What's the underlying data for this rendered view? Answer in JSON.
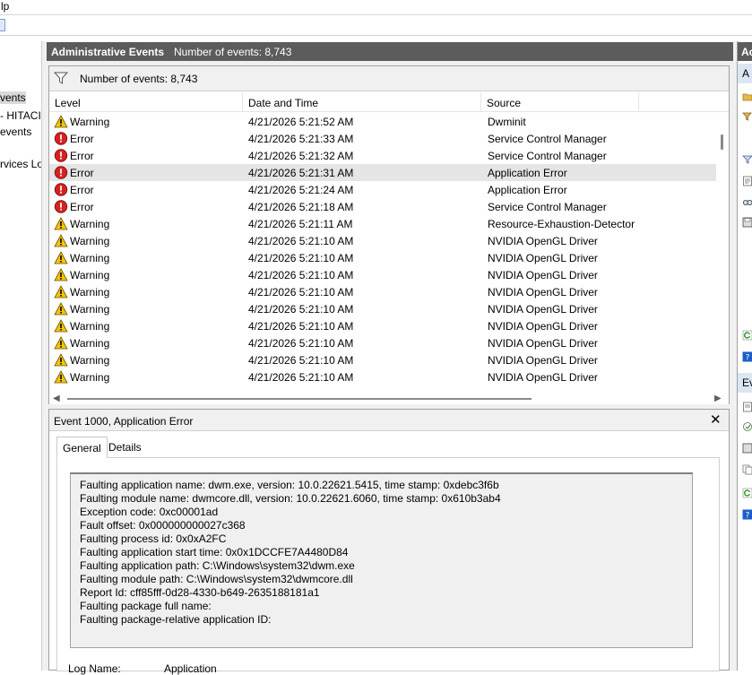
{
  "menubar": {
    "help_fragment": "lp"
  },
  "tree": {
    "items": [
      {
        "label": "vents",
        "selected": true
      },
      {
        "label": "- HITACI",
        "selected": false
      },
      {
        "label": "events",
        "selected": false
      },
      {
        "label": "rvices Lo",
        "selected": false
      }
    ]
  },
  "header": {
    "title": "Administrative Events",
    "count": "Number of events: 8,743"
  },
  "filter": {
    "text": "Number of events: 8,743"
  },
  "grid": {
    "columns": [
      "Level",
      "Date and Time",
      "Source"
    ],
    "rows": [
      {
        "level": "Warning",
        "datetime": "4/21/2026 5:21:52 AM",
        "source": "Dwminit"
      },
      {
        "level": "Error",
        "datetime": "4/21/2026 5:21:33 AM",
        "source": "Service Control Manager"
      },
      {
        "level": "Error",
        "datetime": "4/21/2026 5:21:32 AM",
        "source": "Service Control Manager"
      },
      {
        "level": "Error",
        "datetime": "4/21/2026 5:21:31 AM",
        "source": "Application Error"
      },
      {
        "level": "Error",
        "datetime": "4/21/2026 5:21:24 AM",
        "source": "Application Error"
      },
      {
        "level": "Error",
        "datetime": "4/21/2026 5:21:18 AM",
        "source": "Service Control Manager"
      },
      {
        "level": "Warning",
        "datetime": "4/21/2026 5:21:11 AM",
        "source": "Resource-Exhaustion-Detector"
      },
      {
        "level": "Warning",
        "datetime": "4/21/2026 5:21:10 AM",
        "source": "NVIDIA OpenGL Driver"
      },
      {
        "level": "Warning",
        "datetime": "4/21/2026 5:21:10 AM",
        "source": "NVIDIA OpenGL Driver"
      },
      {
        "level": "Warning",
        "datetime": "4/21/2026 5:21:10 AM",
        "source": "NVIDIA OpenGL Driver"
      },
      {
        "level": "Warning",
        "datetime": "4/21/2026 5:21:10 AM",
        "source": "NVIDIA OpenGL Driver"
      },
      {
        "level": "Warning",
        "datetime": "4/21/2026 5:21:10 AM",
        "source": "NVIDIA OpenGL Driver"
      },
      {
        "level": "Warning",
        "datetime": "4/21/2026 5:21:10 AM",
        "source": "NVIDIA OpenGL Driver"
      },
      {
        "level": "Warning",
        "datetime": "4/21/2026 5:21:10 AM",
        "source": "NVIDIA OpenGL Driver"
      },
      {
        "level": "Warning",
        "datetime": "4/21/2026 5:21:10 AM",
        "source": "NVIDIA OpenGL Driver"
      },
      {
        "level": "Warning",
        "datetime": "4/21/2026 5:21:10 AM",
        "source": "NVIDIA OpenGL Driver"
      }
    ],
    "selected_row": 3
  },
  "detail": {
    "title": "Event 1000, Application Error",
    "close": "✕",
    "tabs": [
      "General",
      "Details"
    ],
    "active_tab": 0,
    "description": [
      "Faulting application name: dwm.exe, version: 10.0.22621.5415, time stamp: 0xdebc3f6b",
      "Faulting module name: dwmcore.dll, version: 10.0.22621.6060, time stamp: 0x610b3ab4",
      "Exception code: 0xc00001ad",
      "Fault offset: 0x000000000027c368",
      "Faulting process id: 0x0xA2FC",
      "Faulting application start time: 0x0x1DCCFE7A4480D84",
      "Faulting application path: C:\\Windows\\system32\\dwm.exe",
      "Faulting module path: C:\\Windows\\system32\\dwmcore.dll",
      "Report Id: cff85fff-0d28-4330-b649-2635188181a1",
      "Faulting package full name:",
      "Faulting package-relative application ID:"
    ],
    "log_name_label": "Log Name:",
    "log_name_value": "Application"
  },
  "actions": {
    "header1": "Ac",
    "sub1": "A",
    "sub2": "Ev"
  },
  "icons": {
    "warning": "warning-icon",
    "error": "error-icon",
    "filter": "filter-icon"
  },
  "colors": {
    "header_bg": "#5c5c5c",
    "warning": "#f5c400",
    "error": "#d42222",
    "selection": "#e5e5e5"
  }
}
